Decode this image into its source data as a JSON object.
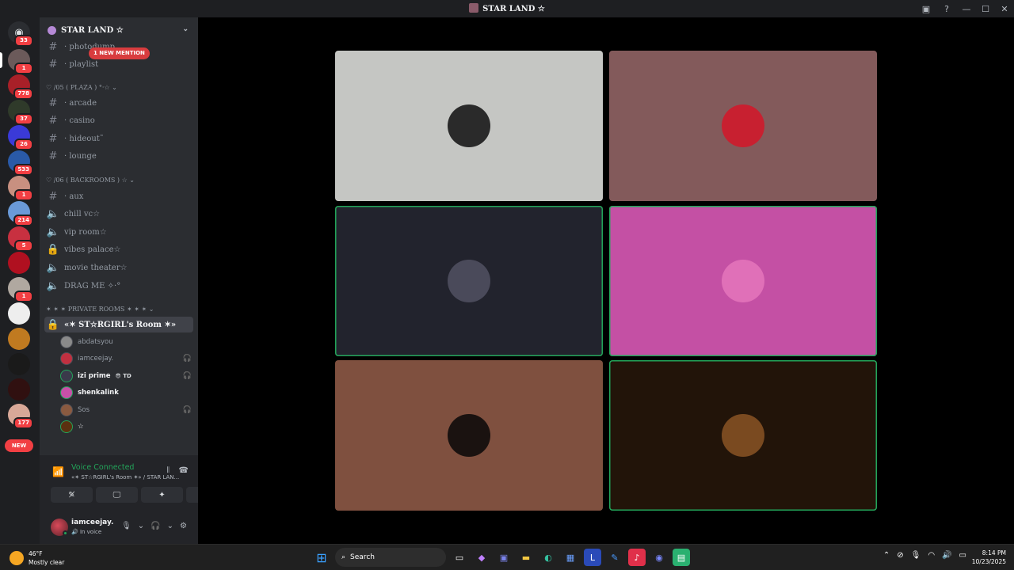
{
  "window": {
    "title": "STAR LAND ☆"
  },
  "guilds": {
    "home_badge": "33",
    "items": [
      {
        "badge": "1",
        "color": "#6b5a5a"
      },
      {
        "badge": "778",
        "color": "#a82028"
      },
      {
        "badge": "37",
        "color": "#2f3a2a"
      },
      {
        "badge": "26",
        "color": "#3a3ad8"
      },
      {
        "badge": "533",
        "color": "#2a5aa8"
      },
      {
        "badge": "1",
        "color": "#c89080"
      },
      {
        "badge": "214",
        "color": "#6a9ad8"
      },
      {
        "badge": "5",
        "color": "#c83040"
      },
      {
        "badge": "",
        "color": "#b01020"
      },
      {
        "badge": "1",
        "color": "#b0a8a0"
      },
      {
        "badge": "",
        "color": "#eeeeee"
      },
      {
        "badge": "",
        "color": "#c07a20"
      },
      {
        "badge": "",
        "color": "#1a1a1a"
      },
      {
        "badge": "",
        "color": "#301010"
      },
      {
        "badge": "177",
        "color": "#d8a898"
      }
    ],
    "new_label": "NEW"
  },
  "server": {
    "name": "STAR LAND ☆",
    "mention_label": "1 NEW MENTION"
  },
  "channels": {
    "top": [
      {
        "icon": "#",
        "name": "· photodump"
      },
      {
        "icon": "#",
        "name": "· playlist"
      }
    ],
    "cat_plaza": "♡ /05 ( PLAZA ) °·☆ ⌄",
    "plaza": [
      {
        "icon": "#",
        "name": "· arcade"
      },
      {
        "icon": "#",
        "name": "· casino"
      },
      {
        "icon": "#",
        "name": "· hideout˜"
      },
      {
        "icon": "#",
        "name": "· lounge"
      }
    ],
    "cat_backrooms": "♡ /06 ( BACKROOMS ) ☆ ⌄",
    "backrooms": [
      {
        "icon": "#",
        "name": "· aux"
      },
      {
        "icon": "🔈",
        "name": "chill vc☆"
      },
      {
        "icon": "🔈",
        "name": "vip room☆"
      },
      {
        "icon": "🔒",
        "name": "vibes palace☆"
      },
      {
        "icon": "🔈",
        "name": "movie theater☆"
      },
      {
        "icon": "🔈",
        "name": "DRAG ME ✧·°"
      }
    ],
    "cat_private": "✶ ✶ ✶ PRIVATE ROOMS ✶ ✶ ✶ ⌄",
    "active_room": "«✶ ST☆RGIRL's Room ✶»"
  },
  "voice_users": [
    {
      "name": "abdatsyou",
      "color": "#8a8a8a",
      "status": "",
      "tag": "",
      "bright": false,
      "speaking": false
    },
    {
      "name": "iamceejay.",
      "color": "#c03040",
      "status": "🎧",
      "tag": "",
      "bright": false,
      "speaking": false
    },
    {
      "name": "izi prime",
      "color": "#3a3a4a",
      "status": "🎧",
      "tag": "😎 TD",
      "bright": true,
      "speaking": true
    },
    {
      "name": "shenkalink",
      "color": "#c850a8",
      "status": "",
      "tag": "",
      "bright": true,
      "speaking": true
    },
    {
      "name": "Sos",
      "color": "#8a5a40",
      "status": "🎧",
      "tag": "",
      "bright": false,
      "speaking": false
    },
    {
      "name": "☆",
      "color": "#5a3010",
      "status": "",
      "tag": "",
      "bright": true,
      "speaking": true
    }
  ],
  "voice_panel": {
    "status": "Voice Connected",
    "location": "«✶ ST☆RGIRL's Room ✶» / STAR LAN...",
    "buttons": [
      "✎̸",
      "🖵",
      "✦",
      "✺"
    ]
  },
  "user": {
    "name": "iamceejay.",
    "status": "🔊 In voice"
  },
  "tiles": [
    {
      "bg": "#c5c6c3",
      "avatar": "#2a2a2a",
      "speaking": false
    },
    {
      "bg": "#835a5b",
      "avatar": "#c82030",
      "speaking": false
    },
    {
      "bg": "#22232d",
      "avatar": "#4a4a5a",
      "speaking": true
    },
    {
      "bg": "#c450a4",
      "avatar": "#e070b8",
      "speaking": true
    },
    {
      "bg": "#7f503f",
      "avatar": "#1a1210",
      "speaking": false
    },
    {
      "bg": "#221409",
      "avatar": "#7a4a20",
      "speaking": true
    }
  ],
  "taskbar": {
    "weather_temp": "46°F",
    "weather_desc": "Mostly clear",
    "search": "Search",
    "time": "8:14 PM",
    "date": "10/23/2025"
  }
}
